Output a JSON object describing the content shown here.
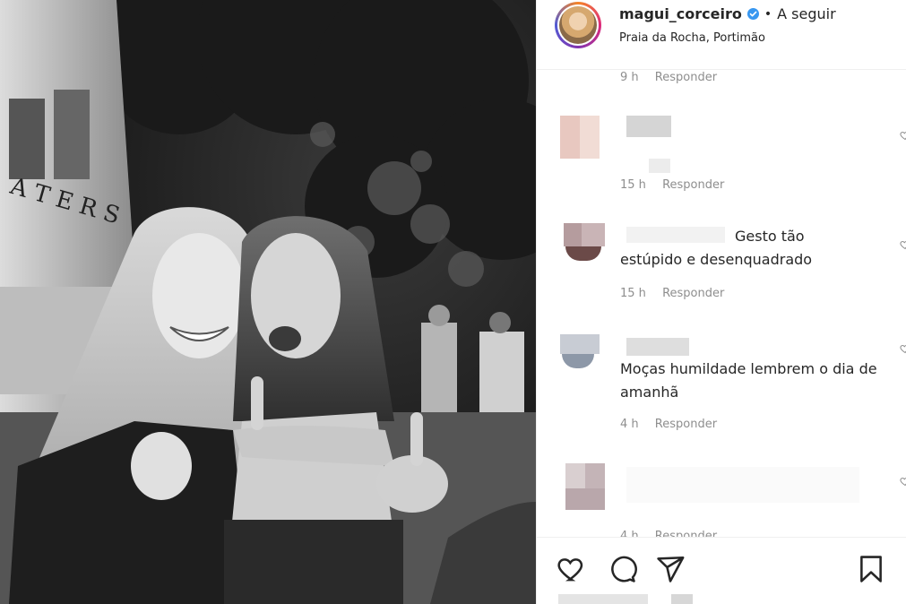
{
  "post": {
    "username": "magui_corceiro",
    "follow_separator": "•",
    "follow_label": "A seguir",
    "location": "Praia da Rocha, Portimão"
  },
  "comments": [
    {
      "time": "9 h",
      "reply": "Responder",
      "text": ""
    },
    {
      "time": "15 h",
      "reply": "Responder",
      "text": ""
    },
    {
      "time": "15 h",
      "reply": "Responder",
      "text_line1": "Gesto tão",
      "text_line2": "estúpido e desenquadrado"
    },
    {
      "time": "4 h",
      "reply": "Responder",
      "text": "Moças humildade lembrem o dia de amanhã"
    },
    {
      "time": "4 h",
      "reply": "Responder",
      "text": ""
    }
  ],
  "icons": {
    "like": "heart-icon",
    "comment": "comment-icon",
    "share": "send-icon",
    "save": "bookmark-icon",
    "verified": "verified-badge-icon"
  },
  "colors": {
    "text": "#262626",
    "muted": "#8e8e8e",
    "verified": "#3897f0",
    "border": "#efefef"
  }
}
